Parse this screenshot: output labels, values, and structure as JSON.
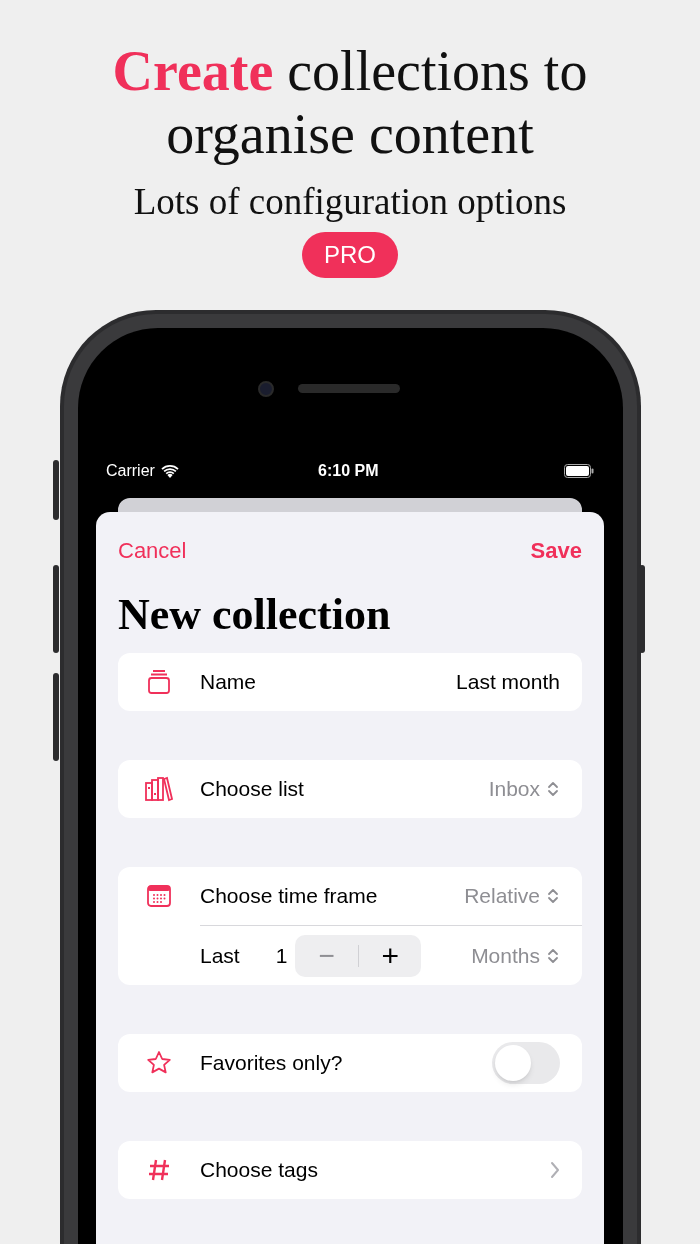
{
  "headline": {
    "accent": "Create",
    "rest": "collections to organise content"
  },
  "subtitle": "Lots of configuration options",
  "badge": "PRO",
  "status_bar": {
    "carrier": "Carrier",
    "time": "6:10 PM"
  },
  "nav": {
    "cancel": "Cancel",
    "save": "Save"
  },
  "title": "New collection",
  "rows": [
    {
      "kind": "text",
      "label": "Name",
      "value": "Last month"
    },
    {
      "kind": "picker",
      "label": "Choose list",
      "value": "Inbox"
    },
    {
      "kind": "timeframe",
      "label": "Choose time frame",
      "value": "Relative",
      "sub_label": "Last",
      "count": "1",
      "minus": "−",
      "plus": "+",
      "unit": "Months"
    },
    {
      "kind": "toggle",
      "label": "Favorites only?",
      "on": false
    },
    {
      "kind": "link",
      "label": "Choose tags"
    }
  ]
}
